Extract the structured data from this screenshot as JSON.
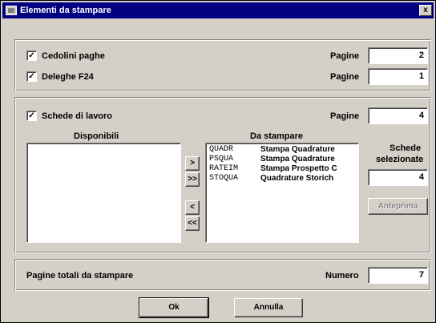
{
  "window": {
    "title": "Elementi da stampare",
    "close_glyph": "x"
  },
  "group1": {
    "rows": [
      {
        "label": "Cedolini paghe",
        "checked": true,
        "pages_label": "Pagine",
        "pages": "2"
      },
      {
        "label": "Deleghe F24",
        "checked": true,
        "pages_label": "Pagine",
        "pages": "1"
      }
    ]
  },
  "group2": {
    "label": "Schede di lavoro",
    "checked": true,
    "pages_label": "Pagine",
    "pages": "4",
    "available_title": "Disponibili",
    "to_print_title": "Da stampare",
    "to_print_items": [
      {
        "code": "QUADR",
        "desc": "Stampa Quadrature"
      },
      {
        "code": "PSQUA",
        "desc": "Stampa Quadrature"
      },
      {
        "code": "RATEIM",
        "desc": "Stampa Prospetto C"
      },
      {
        "code": "STOQUA",
        "desc": "Quadrature Storich"
      }
    ],
    "move_buttons": [
      ">",
      ">>",
      "<",
      "<<"
    ],
    "selected_label_line1": "Schede",
    "selected_label_line2": "selezionate",
    "selected_count": "4",
    "preview_button": "Anteprima"
  },
  "group3": {
    "label": "Pagine totali da stampare",
    "number_label": "Numero",
    "number": "7"
  },
  "footer": {
    "ok": "Ok",
    "cancel": "Annulla"
  },
  "check_glyph": "✓"
}
